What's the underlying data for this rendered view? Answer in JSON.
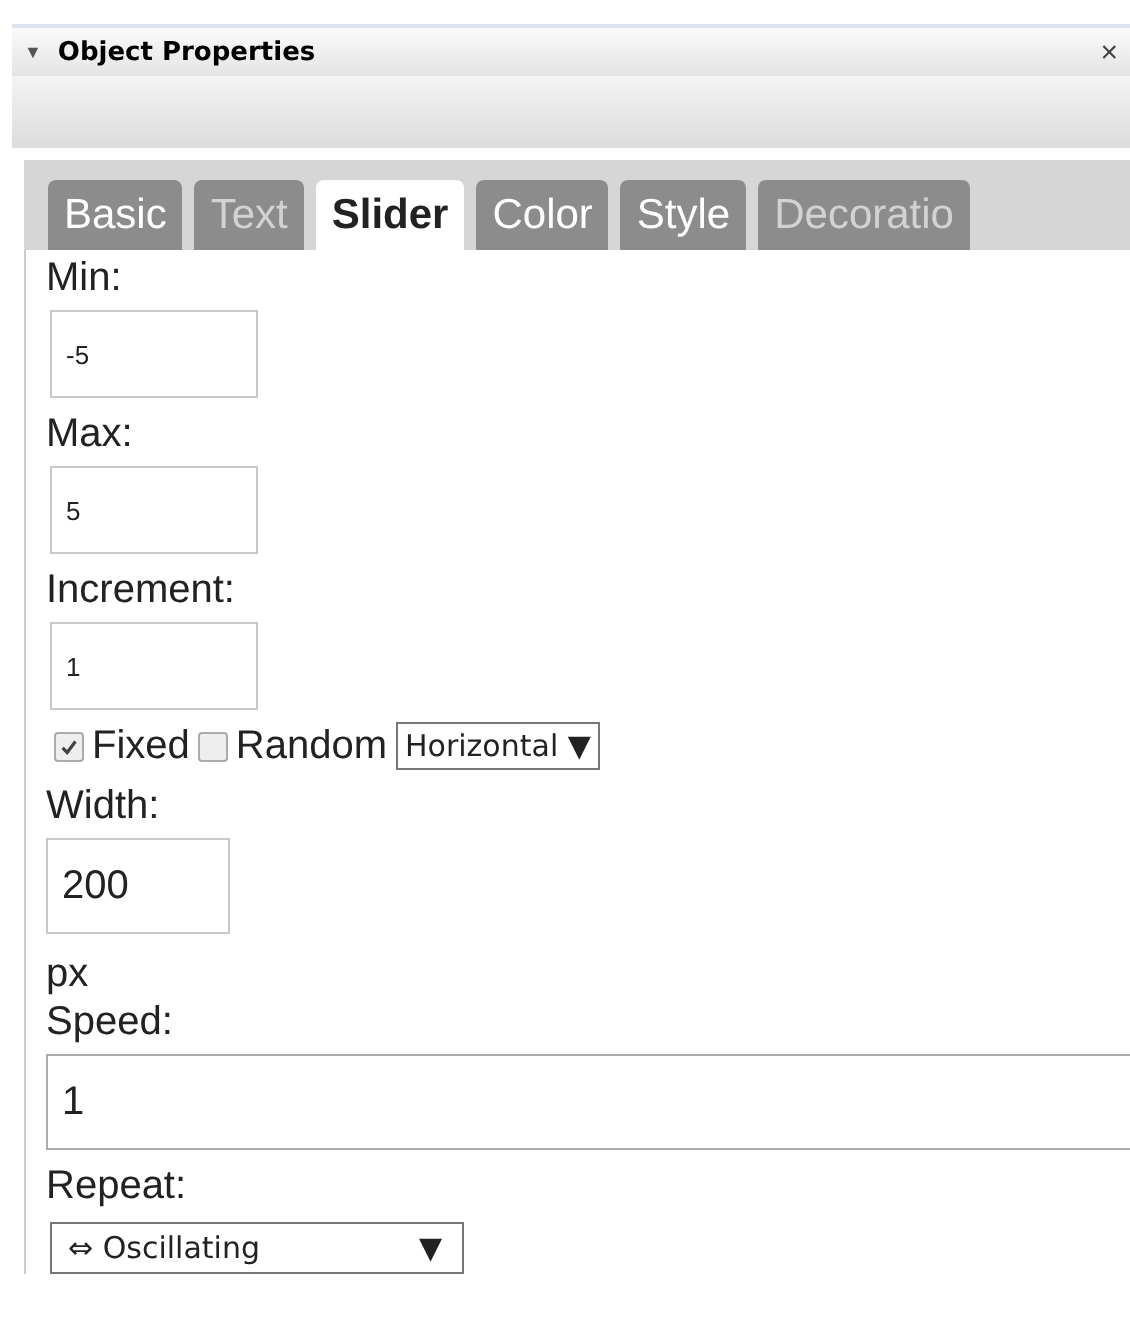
{
  "panel": {
    "collapse_icon": "▼",
    "title": "Object Properties",
    "close": "×"
  },
  "tabs": [
    {
      "label": "Basic",
      "selected": false,
      "disabled": false
    },
    {
      "label": "Text",
      "selected": false,
      "disabled": true
    },
    {
      "label": "Slider",
      "selected": true,
      "disabled": false
    },
    {
      "label": "Color",
      "selected": false,
      "disabled": false
    },
    {
      "label": "Style",
      "selected": false,
      "disabled": false
    },
    {
      "label": "Decoratio",
      "selected": false,
      "disabled": true
    }
  ],
  "fields": [
    {
      "kind": "small",
      "label": "Min:",
      "value": "-5"
    },
    {
      "kind": "small",
      "label": "Max:",
      "value": "5"
    },
    {
      "kind": "small",
      "label": "Increment:",
      "value": "1"
    }
  ],
  "mode": {
    "fixed": {
      "label": "Fixed",
      "checked": true
    },
    "random": {
      "label": "Random",
      "checked": false
    },
    "orientation": {
      "value": "Horizontal",
      "arrow": "▼"
    }
  },
  "width": {
    "label": "Width:",
    "value": "200",
    "unit": "px"
  },
  "speed": {
    "label": "Speed:",
    "value": "1"
  },
  "repeat": {
    "label": "Repeat:",
    "value": "⇔ Oscillating",
    "arrow": "▼"
  }
}
